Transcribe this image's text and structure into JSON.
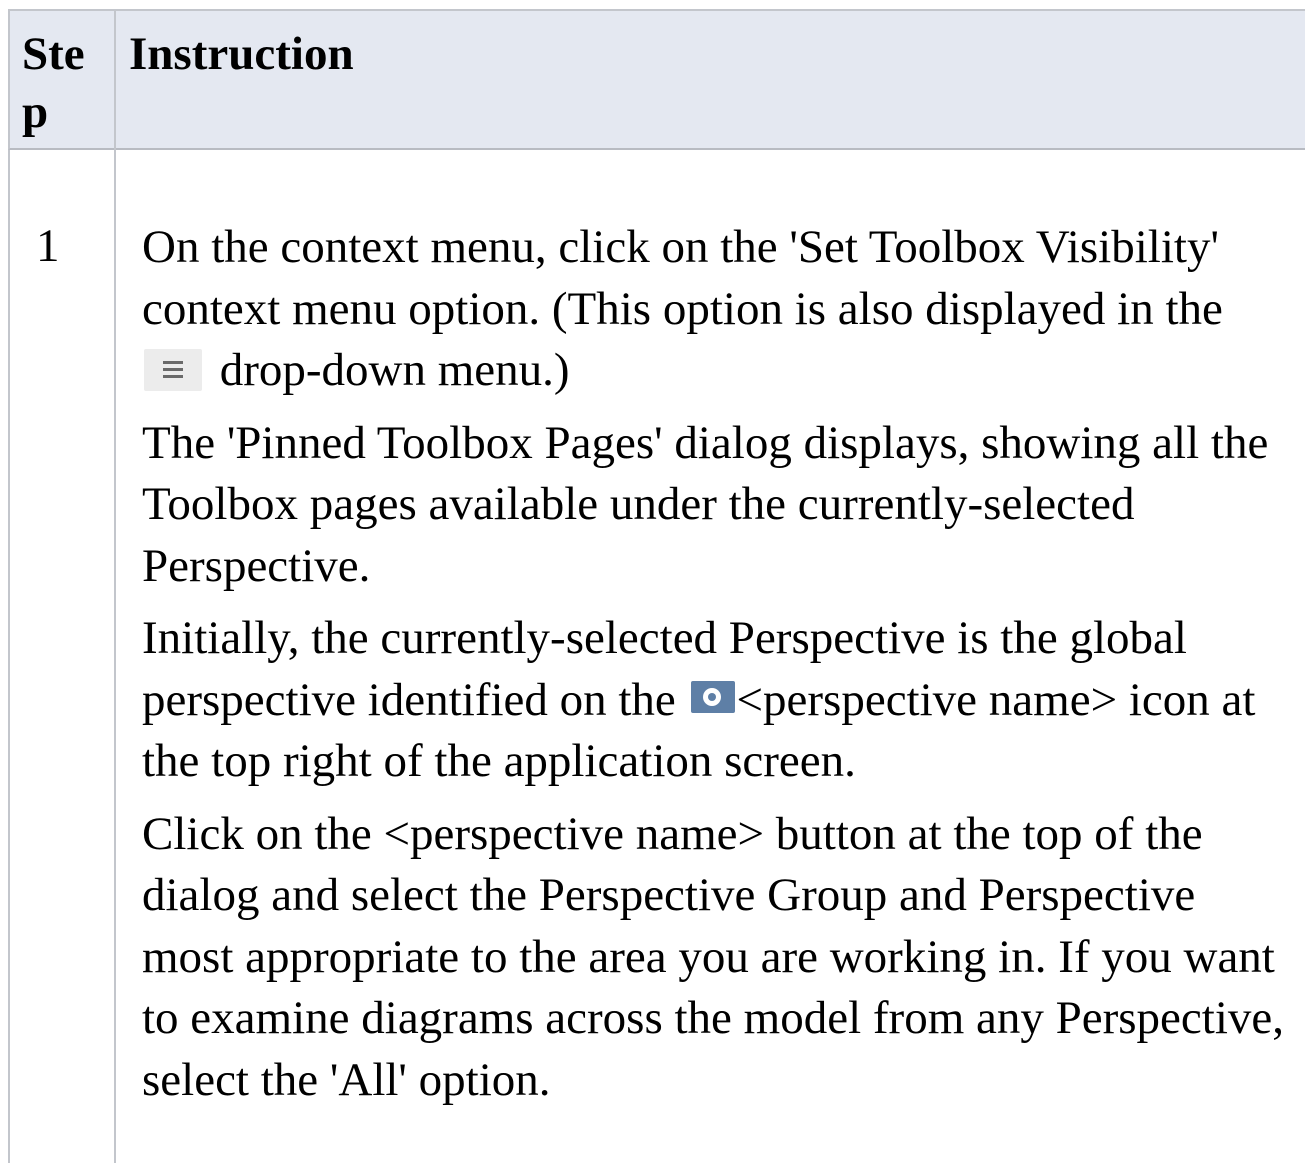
{
  "table": {
    "header": {
      "step": "Step",
      "instruction": "Instruction"
    },
    "rows": [
      {
        "step": "1",
        "paragraphs": {
          "p1_before_icon": "On the context menu, click on the 'Set Toolbox Visibility' context menu option. (This option is also displayed in the",
          "p1_icon": "hamburger-menu-icon",
          "p1_after_icon": "drop-down menu.)",
          "p2": "The 'Pinned Toolbox Pages' dialog displays, showing all the Toolbox pages available under the currently-selected Perspective.",
          "p3_before_icon": "Initially, the currently-selected Perspective is the global perspective identified on the",
          "p3_icon": "eye-icon",
          "p3_after_icon": "<perspective name> icon at the top right of the application screen.",
          "p4": "Click on the <perspective name> button at the top of the dialog and select the Perspective Group and Perspective most appropriate to the area you are working in. If you want to examine diagrams across the model from any Perspective, select the 'All' option."
        }
      }
    ]
  },
  "colors": {
    "header_background": "#e4e8f1",
    "border": "#c3c6cc",
    "eye_icon": "#5e7fa6"
  }
}
